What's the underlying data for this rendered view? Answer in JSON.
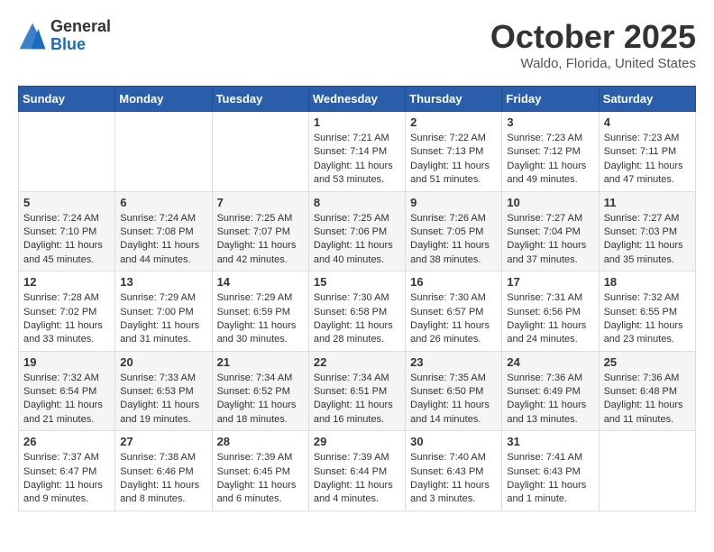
{
  "header": {
    "logo_general": "General",
    "logo_blue": "Blue",
    "month_title": "October 2025",
    "location": "Waldo, Florida, United States"
  },
  "weekdays": [
    "Sunday",
    "Monday",
    "Tuesday",
    "Wednesday",
    "Thursday",
    "Friday",
    "Saturday"
  ],
  "weeks": [
    [
      {
        "day": "",
        "sunrise": "",
        "sunset": "",
        "daylight": ""
      },
      {
        "day": "",
        "sunrise": "",
        "sunset": "",
        "daylight": ""
      },
      {
        "day": "",
        "sunrise": "",
        "sunset": "",
        "daylight": ""
      },
      {
        "day": "1",
        "sunrise": "7:21 AM",
        "sunset": "7:14 PM",
        "daylight": "11 hours and 53 minutes."
      },
      {
        "day": "2",
        "sunrise": "7:22 AM",
        "sunset": "7:13 PM",
        "daylight": "11 hours and 51 minutes."
      },
      {
        "day": "3",
        "sunrise": "7:23 AM",
        "sunset": "7:12 PM",
        "daylight": "11 hours and 49 minutes."
      },
      {
        "day": "4",
        "sunrise": "7:23 AM",
        "sunset": "7:11 PM",
        "daylight": "11 hours and 47 minutes."
      }
    ],
    [
      {
        "day": "5",
        "sunrise": "7:24 AM",
        "sunset": "7:10 PM",
        "daylight": "11 hours and 45 minutes."
      },
      {
        "day": "6",
        "sunrise": "7:24 AM",
        "sunset": "7:08 PM",
        "daylight": "11 hours and 44 minutes."
      },
      {
        "day": "7",
        "sunrise": "7:25 AM",
        "sunset": "7:07 PM",
        "daylight": "11 hours and 42 minutes."
      },
      {
        "day": "8",
        "sunrise": "7:25 AM",
        "sunset": "7:06 PM",
        "daylight": "11 hours and 40 minutes."
      },
      {
        "day": "9",
        "sunrise": "7:26 AM",
        "sunset": "7:05 PM",
        "daylight": "11 hours and 38 minutes."
      },
      {
        "day": "10",
        "sunrise": "7:27 AM",
        "sunset": "7:04 PM",
        "daylight": "11 hours and 37 minutes."
      },
      {
        "day": "11",
        "sunrise": "7:27 AM",
        "sunset": "7:03 PM",
        "daylight": "11 hours and 35 minutes."
      }
    ],
    [
      {
        "day": "12",
        "sunrise": "7:28 AM",
        "sunset": "7:02 PM",
        "daylight": "11 hours and 33 minutes."
      },
      {
        "day": "13",
        "sunrise": "7:29 AM",
        "sunset": "7:00 PM",
        "daylight": "11 hours and 31 minutes."
      },
      {
        "day": "14",
        "sunrise": "7:29 AM",
        "sunset": "6:59 PM",
        "daylight": "11 hours and 30 minutes."
      },
      {
        "day": "15",
        "sunrise": "7:30 AM",
        "sunset": "6:58 PM",
        "daylight": "11 hours and 28 minutes."
      },
      {
        "day": "16",
        "sunrise": "7:30 AM",
        "sunset": "6:57 PM",
        "daylight": "11 hours and 26 minutes."
      },
      {
        "day": "17",
        "sunrise": "7:31 AM",
        "sunset": "6:56 PM",
        "daylight": "11 hours and 24 minutes."
      },
      {
        "day": "18",
        "sunrise": "7:32 AM",
        "sunset": "6:55 PM",
        "daylight": "11 hours and 23 minutes."
      }
    ],
    [
      {
        "day": "19",
        "sunrise": "7:32 AM",
        "sunset": "6:54 PM",
        "daylight": "11 hours and 21 minutes."
      },
      {
        "day": "20",
        "sunrise": "7:33 AM",
        "sunset": "6:53 PM",
        "daylight": "11 hours and 19 minutes."
      },
      {
        "day": "21",
        "sunrise": "7:34 AM",
        "sunset": "6:52 PM",
        "daylight": "11 hours and 18 minutes."
      },
      {
        "day": "22",
        "sunrise": "7:34 AM",
        "sunset": "6:51 PM",
        "daylight": "11 hours and 16 minutes."
      },
      {
        "day": "23",
        "sunrise": "7:35 AM",
        "sunset": "6:50 PM",
        "daylight": "11 hours and 14 minutes."
      },
      {
        "day": "24",
        "sunrise": "7:36 AM",
        "sunset": "6:49 PM",
        "daylight": "11 hours and 13 minutes."
      },
      {
        "day": "25",
        "sunrise": "7:36 AM",
        "sunset": "6:48 PM",
        "daylight": "11 hours and 11 minutes."
      }
    ],
    [
      {
        "day": "26",
        "sunrise": "7:37 AM",
        "sunset": "6:47 PM",
        "daylight": "11 hours and 9 minutes."
      },
      {
        "day": "27",
        "sunrise": "7:38 AM",
        "sunset": "6:46 PM",
        "daylight": "11 hours and 8 minutes."
      },
      {
        "day": "28",
        "sunrise": "7:39 AM",
        "sunset": "6:45 PM",
        "daylight": "11 hours and 6 minutes."
      },
      {
        "day": "29",
        "sunrise": "7:39 AM",
        "sunset": "6:44 PM",
        "daylight": "11 hours and 4 minutes."
      },
      {
        "day": "30",
        "sunrise": "7:40 AM",
        "sunset": "6:43 PM",
        "daylight": "11 hours and 3 minutes."
      },
      {
        "day": "31",
        "sunrise": "7:41 AM",
        "sunset": "6:43 PM",
        "daylight": "11 hours and 1 minute."
      },
      {
        "day": "",
        "sunrise": "",
        "sunset": "",
        "daylight": ""
      }
    ]
  ]
}
